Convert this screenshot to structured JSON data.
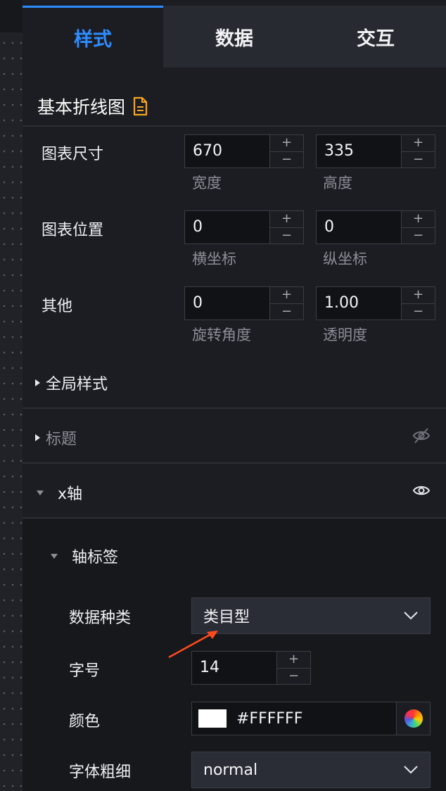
{
  "tabs": [
    {
      "label": "样式",
      "active": true
    },
    {
      "label": "数据",
      "active": false
    },
    {
      "label": "交互",
      "active": false
    }
  ],
  "component_title": "基本折线图",
  "stepper": {
    "plus": "+",
    "minus": "−"
  },
  "chart_size": {
    "label": "图表尺寸",
    "width": {
      "value": "670",
      "label": "宽度"
    },
    "height": {
      "value": "335",
      "label": "高度"
    }
  },
  "chart_position": {
    "label": "图表位置",
    "x": {
      "value": "0",
      "label": "横坐标"
    },
    "y": {
      "value": "0",
      "label": "纵坐标"
    }
  },
  "other": {
    "label": "其他",
    "rotation": {
      "value": "0",
      "label": "旋转角度"
    },
    "opacity": {
      "value": "1.00",
      "label": "透明度"
    }
  },
  "sections": {
    "global_style": "全局样式",
    "title": "标题",
    "x_axis": "x轴",
    "axis_labels": "轴标签"
  },
  "axis_label_props": {
    "data_type": {
      "label": "数据种类",
      "value": "类目型"
    },
    "font_size": {
      "label": "字号",
      "value": "14"
    },
    "color": {
      "label": "颜色",
      "value": "#FFFFFF",
      "swatch": "#ffffff"
    },
    "font_weight": {
      "label": "字体粗细",
      "value": "normal"
    }
  },
  "colors": {
    "accent": "#2f8cff",
    "annotation_arrow": "#ff4a1c",
    "doc_icon": "#f5a623"
  },
  "icons": {
    "doc": "document-icon",
    "eye_hidden": "eye-slash-icon",
    "eye_visible": "eye-icon",
    "chevron": "chevron-down-icon",
    "picker": "color-wheel-icon"
  }
}
